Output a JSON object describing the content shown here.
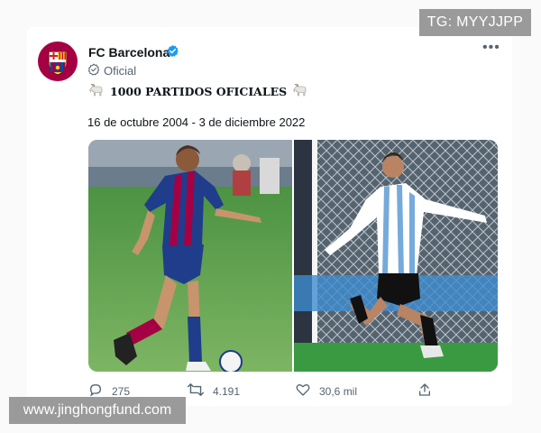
{
  "watermarks": {
    "top": "TG: MYYJJPP",
    "bottom": "www.jinghongfund.com"
  },
  "account": {
    "name": "FC Barcelona",
    "label": "Oficial"
  },
  "post": {
    "headline": "1000 PARTIDOS OFICIALES",
    "dates": "16 de octubre 2004 - 3 de diciembre 2022"
  },
  "stats": {
    "replies": "275",
    "retweets": "4.191",
    "likes": "30,6 mil"
  },
  "icons": {
    "avatar": "fc-barcelona-crest",
    "verified": "verified-badge-icon",
    "official": "official-check-icon",
    "goat": "goat-emoji",
    "more": "more-icon",
    "reply": "reply-icon",
    "retweet": "retweet-icon",
    "like": "heart-icon",
    "share": "share-icon"
  },
  "colors": {
    "barca_blue": "#004d98",
    "barca_garnet": "#a50044",
    "verified": "#1d9bf0",
    "argentina_sky": "#75aadb"
  }
}
